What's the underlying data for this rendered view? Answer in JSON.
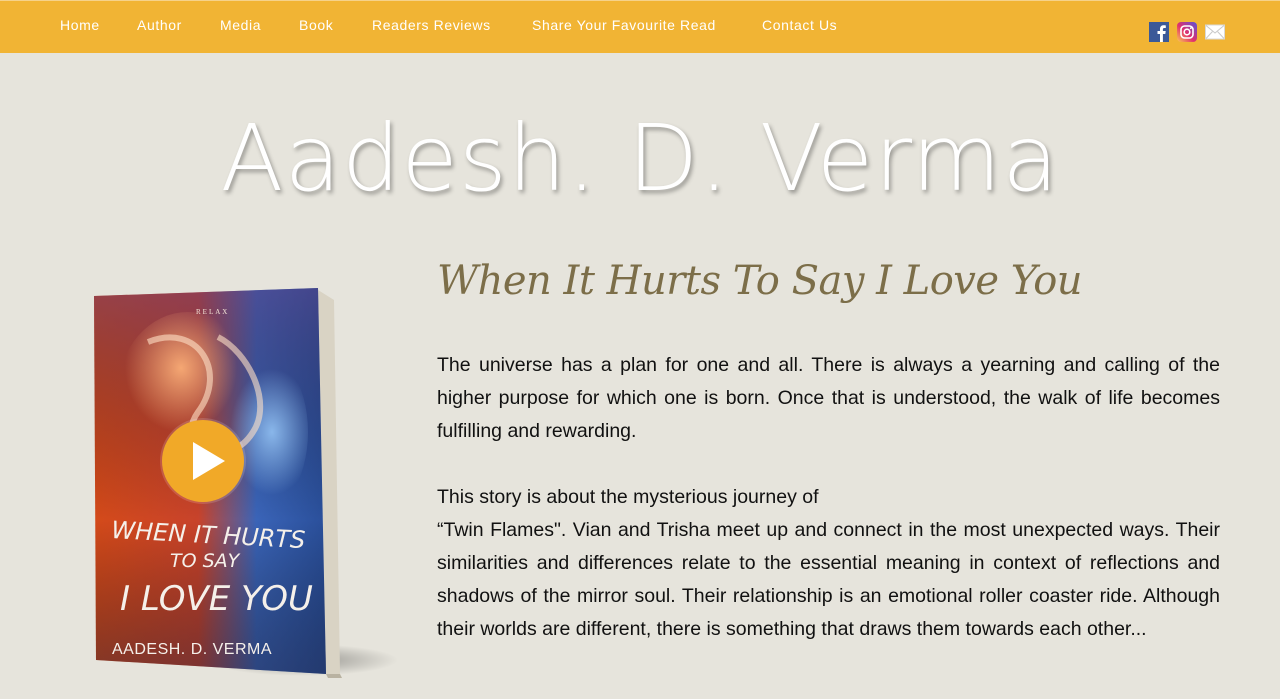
{
  "nav": {
    "items": [
      {
        "label": "Home"
      },
      {
        "label": "Author"
      },
      {
        "label": "Media"
      },
      {
        "label": "Book"
      },
      {
        "label": "Readers Reviews"
      },
      {
        "label": "Share Your Favourite Read"
      },
      {
        "label": "Contact Us"
      }
    ]
  },
  "social": {
    "icons": [
      "facebook-icon",
      "instagram-icon",
      "mail-icon"
    ],
    "colors": {
      "facebook": "#3b5998",
      "instagram": "#c13584",
      "mail": "#ffffff"
    }
  },
  "site": {
    "title": "Aadesh. D. Verma"
  },
  "book": {
    "cover": {
      "small_text": "RELAX",
      "title_line1": "WHEN IT HURTS",
      "title_line2": "TO SAY",
      "title_line3": "I LOVE YOU",
      "author": "AADESH. D. VERMA"
    },
    "title": "When It Hurts To Say I Love You",
    "paragraph1": "The universe has a plan for one and all. There is always a yearning and calling of the higher purpose for which one is born. Once that is understood, the walk of life becomes fulfilling and rewarding.",
    "paragraph2_line1": "This story is about the mysterious journey of",
    "paragraph2_rest": "“Twin Flames\". Vian and Trisha meet up and connect in the most unexpected ways. Their similarities and differences relate to the essential meaning in context of reflections and shadows of the mirror soul. Their relationship is an emotional roller coaster ride. Although their worlds are different, there is something that draws them towards each other..."
  },
  "theme": {
    "accent": "#f1b434",
    "background": "#e6e4dc",
    "title_color": "#7c6e49",
    "play_button": "#f1a928"
  }
}
